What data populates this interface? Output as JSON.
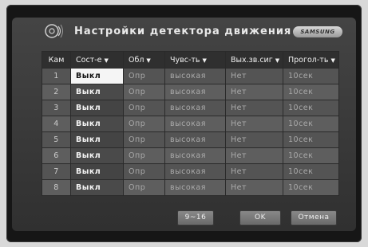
{
  "window": {
    "title": "Настройки детектора движения",
    "brand": "SAMSUNG"
  },
  "columns": [
    {
      "label": "Кам",
      "dropdown": false
    },
    {
      "label": "Сост-е",
      "dropdown": true
    },
    {
      "label": "Обл",
      "dropdown": true
    },
    {
      "label": "Чувс-ть",
      "dropdown": true
    },
    {
      "label": "Вых.зв.сиг",
      "dropdown": true
    },
    {
      "label": "Прогол-ть",
      "dropdown": true
    }
  ],
  "rows": [
    {
      "cam": "1",
      "state": "Выкл",
      "area": "Опр",
      "sensitivity": "высокая",
      "sound_out": "Нет",
      "interval": "10сек"
    },
    {
      "cam": "2",
      "state": "Выкл",
      "area": "Опр",
      "sensitivity": "высокая",
      "sound_out": "Нет",
      "interval": "10сек"
    },
    {
      "cam": "3",
      "state": "Выкл",
      "area": "Опр",
      "sensitivity": "высокая",
      "sound_out": "Нет",
      "interval": "10сек"
    },
    {
      "cam": "4",
      "state": "Выкл",
      "area": "Опр",
      "sensitivity": "высокая",
      "sound_out": "Нет",
      "interval": "10сек"
    },
    {
      "cam": "5",
      "state": "Выкл",
      "area": "Опр",
      "sensitivity": "высокая",
      "sound_out": "Нет",
      "interval": "10сек"
    },
    {
      "cam": "6",
      "state": "Выкл",
      "area": "Опр",
      "sensitivity": "высокая",
      "sound_out": "Нет",
      "interval": "10сек"
    },
    {
      "cam": "7",
      "state": "Выкл",
      "area": "Опр",
      "sensitivity": "высокая",
      "sound_out": "Нет",
      "interval": "10сек"
    },
    {
      "cam": "8",
      "state": "Выкл",
      "area": "Опр",
      "sensitivity": "высокая",
      "sound_out": "Нет",
      "interval": "10сек"
    }
  ],
  "selected_row": 0,
  "buttons": {
    "next_page": "9~16",
    "ok": "OK",
    "cancel": "Отмена"
  },
  "icons": {
    "title": "motion-detector-icon",
    "dropdown": "chevron-down-icon"
  },
  "colors": {
    "panel": "#3c3c3c",
    "selected_cell": "#f5f5f5",
    "header_text": "#f0f0f0"
  }
}
